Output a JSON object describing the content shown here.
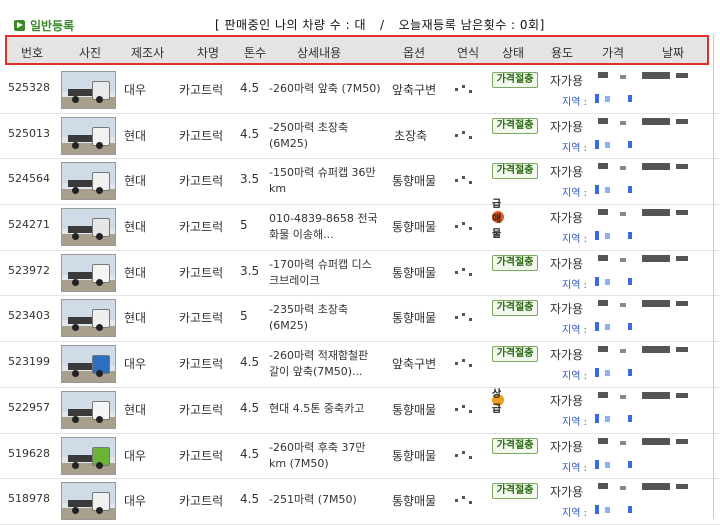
{
  "tab": {
    "label": "일반등록"
  },
  "summary": {
    "left": "[ 판매중인 나의 차량 수 : 대",
    "sep": "/",
    "right": "오늘재등록 남은횟수 : 0회]"
  },
  "columns": [
    "번호",
    "사진",
    "제조사",
    "차명",
    "톤수",
    "상세내용",
    "옵션",
    "연식",
    "상태",
    "용도",
    "가격",
    "날짜"
  ],
  "region_label": "지역 :",
  "colors": {
    "accent_green": "#3a8a2a",
    "header_border": "#e0302a",
    "header_bg": "#e4e4e4",
    "region_blue": "#2a55c0"
  },
  "rows": [
    {
      "id": "525328",
      "maker": "대우",
      "model": "카고트럭",
      "ton": "4.5",
      "detail": "-260마력 앞축 (7M50)",
      "option": "앞축구변",
      "status": "가격절충",
      "status_type": "nego",
      "use": "자가용",
      "truck_color": "#eaeaea"
    },
    {
      "id": "525013",
      "maker": "현대",
      "model": "카고트럭",
      "ton": "4.5",
      "detail": "-250마력 초장축 (6M25)",
      "option": "초장축",
      "status": "가격절충",
      "status_type": "nego",
      "use": "자가용",
      "truck_color": "#f2f2f2"
    },
    {
      "id": "524564",
      "maker": "현대",
      "model": "카고트럭",
      "ton": "3.5",
      "detail": "-150마력 슈퍼캡 36만 km",
      "option": "통향매물",
      "status": "가격절충",
      "status_type": "nego",
      "use": "자가용",
      "truck_color": "#f0f0f0"
    },
    {
      "id": "524271",
      "maker": "현대",
      "model": "카고트럭",
      "ton": "5",
      "detail": "010-4839-8658 전국화물 이송해...",
      "option": "통향매물",
      "status": "급매물",
      "status_type": "urgent",
      "use": "자가용",
      "truck_color": "#e6e6e6"
    },
    {
      "id": "523972",
      "maker": "현대",
      "model": "카고트럭",
      "ton": "3.5",
      "detail": "-170마력 슈퍼캡 디스크브레이크",
      "option": "통향매물",
      "status": "가격절충",
      "status_type": "nego",
      "use": "자가용",
      "truck_color": "#f4f4f4"
    },
    {
      "id": "523403",
      "maker": "현대",
      "model": "카고트럭",
      "ton": "5",
      "detail": "-235마력 초장축 (6M25)",
      "option": "통향매물",
      "status": "가격절충",
      "status_type": "nego",
      "use": "자가용",
      "truck_color": "#efefef"
    },
    {
      "id": "523199",
      "maker": "대우",
      "model": "카고트럭",
      "ton": "4.5",
      "detail": "-260마력 적재함철판 갈이 앞축(7M50)...",
      "option": "앞축구변",
      "status": "가격절충",
      "status_type": "nego",
      "use": "자가용",
      "truck_color": "#2c6fc0"
    },
    {
      "id": "522957",
      "maker": "현대",
      "model": "카고트럭",
      "ton": "4.5",
      "detail": "현대 4.5톤 중축카고",
      "option": "통향매물",
      "status": "상급",
      "status_type": "grade",
      "use": "자가용",
      "truck_color": "#f5f5f5"
    },
    {
      "id": "519628",
      "maker": "대우",
      "model": "카고트럭",
      "ton": "4.5",
      "detail": "-260마력 후축 37만 km (7M50)",
      "option": "통향매물",
      "status": "가격절충",
      "status_type": "nego",
      "use": "자가용",
      "truck_color": "#6ab43a"
    },
    {
      "id": "518978",
      "maker": "대우",
      "model": "카고트럭",
      "ton": "4.5",
      "detail": "-251마력 (7M50)",
      "option": "통향매물",
      "status": "가격절충",
      "status_type": "nego",
      "use": "자가용",
      "truck_color": "#f0f0f0"
    }
  ]
}
